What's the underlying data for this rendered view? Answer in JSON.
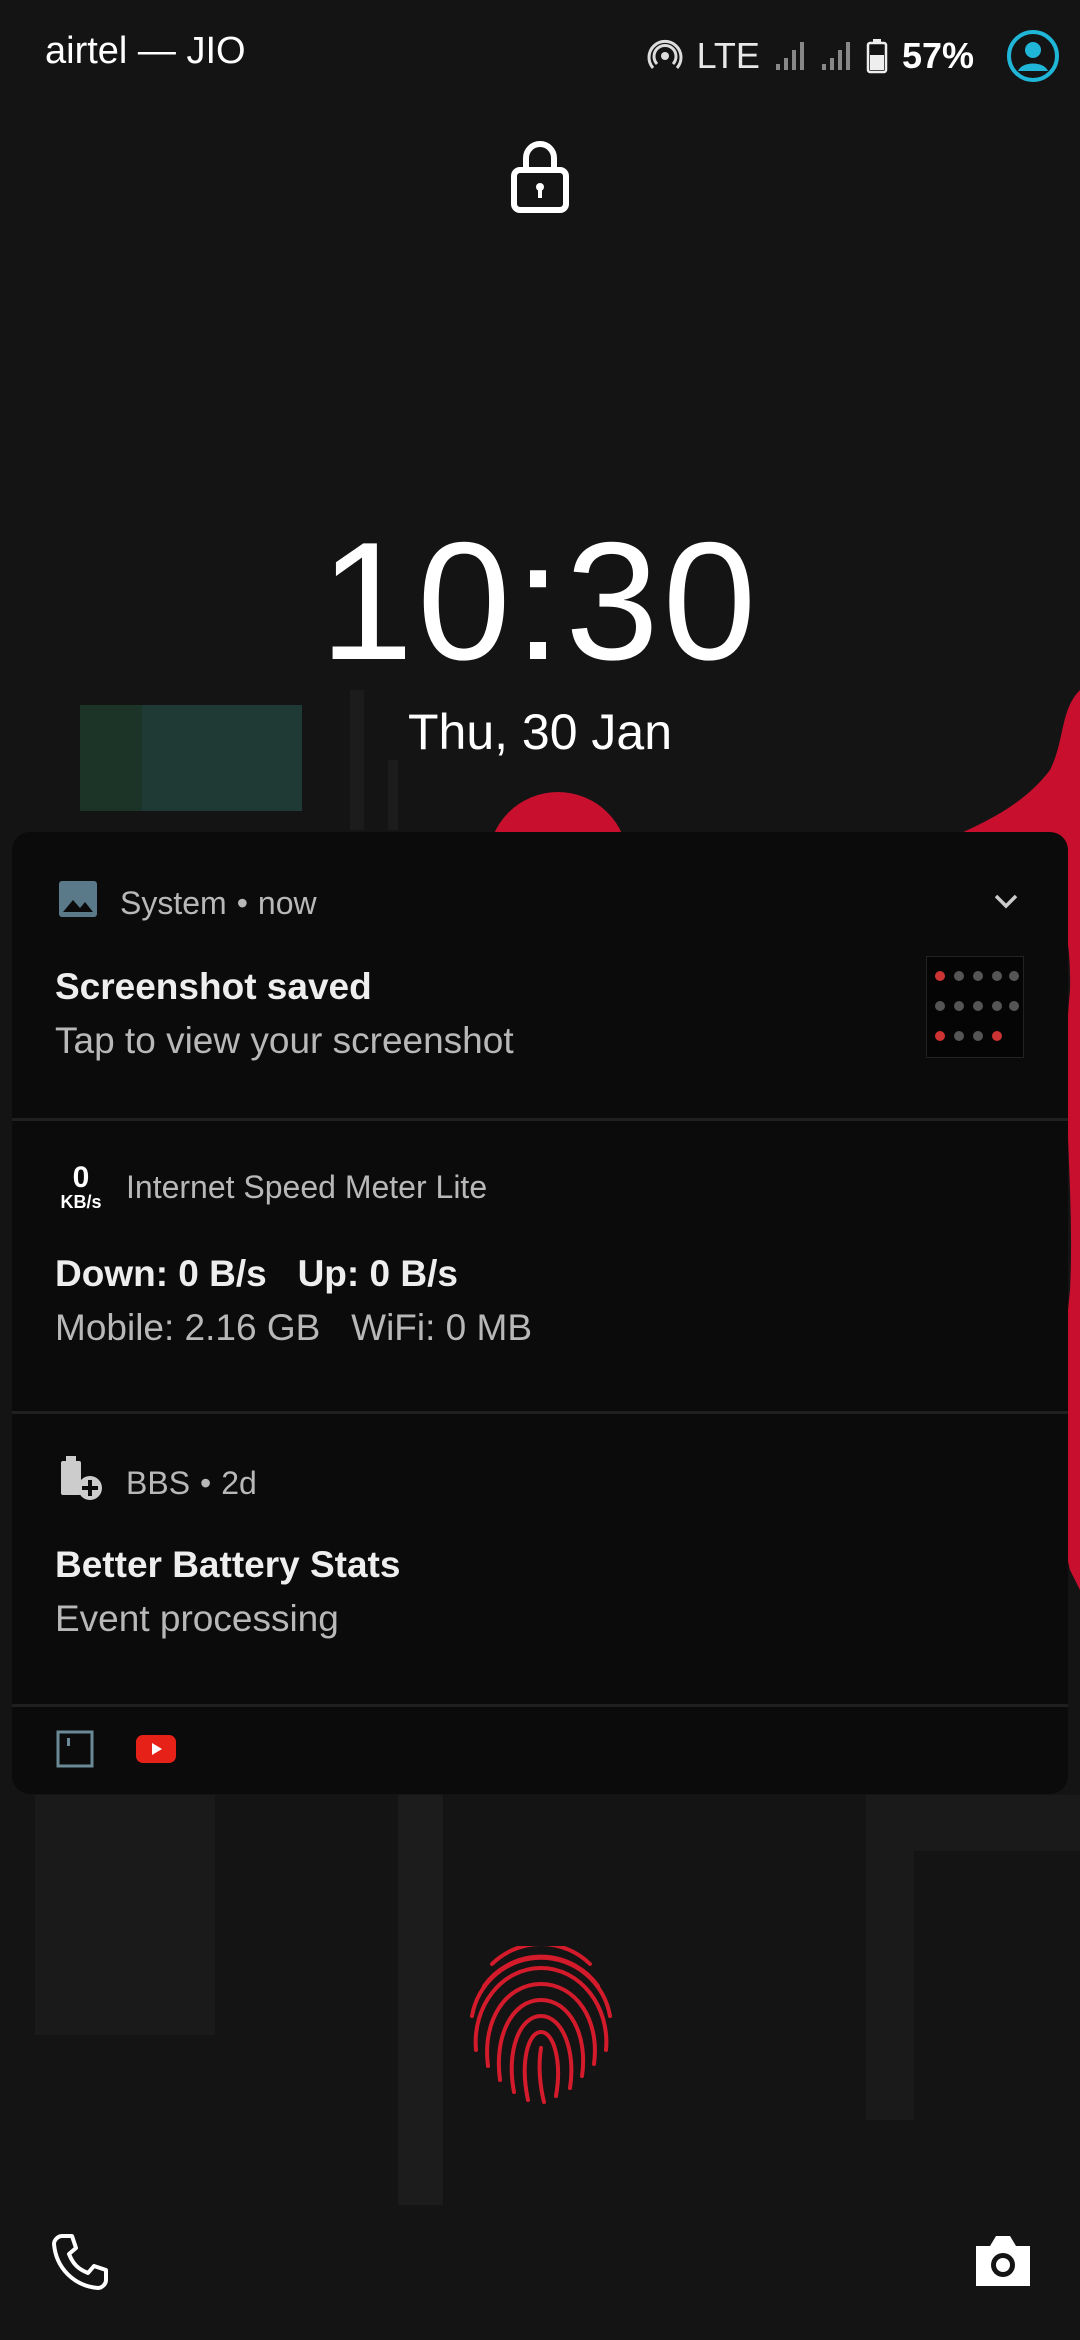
{
  "status_bar": {
    "carrier": "airtel — JIO",
    "network": "LTE",
    "battery": "57%",
    "icons": [
      "hotspot-icon",
      "signal-icon",
      "signal-icon",
      "battery-icon",
      "account-icon"
    ]
  },
  "lock_icon": "lock-icon",
  "clock": {
    "time": "10:30",
    "date": "Thu, 30 Jan"
  },
  "notifications": [
    {
      "app": "System",
      "time": "now",
      "icon": "image-icon",
      "title": "Screenshot saved",
      "text": "Tap to view your screenshot"
    },
    {
      "speed_value": "0",
      "speed_unit": "KB/s",
      "app": "Internet Speed Meter Lite",
      "title": "Down: 0 B/s   Up: 0 B/s",
      "text": "Mobile: 2.16 GB   WiFi: 0 MB"
    },
    {
      "app": "BBS",
      "time": "2d",
      "icon": "battery-plus-icon",
      "title": "Better Battery Stats",
      "text": "Event processing"
    }
  ],
  "footer_icons": [
    "tablet-icon",
    "youtube-icon"
  ],
  "bottom": {
    "left_shortcut": "phone-icon",
    "right_shortcut": "camera-icon",
    "fingerprint": "fingerprint-icon"
  },
  "colors": {
    "accent_red": "#d41b2b",
    "account_blue": "#1fb6d8",
    "panel": "#0b0b0b"
  }
}
